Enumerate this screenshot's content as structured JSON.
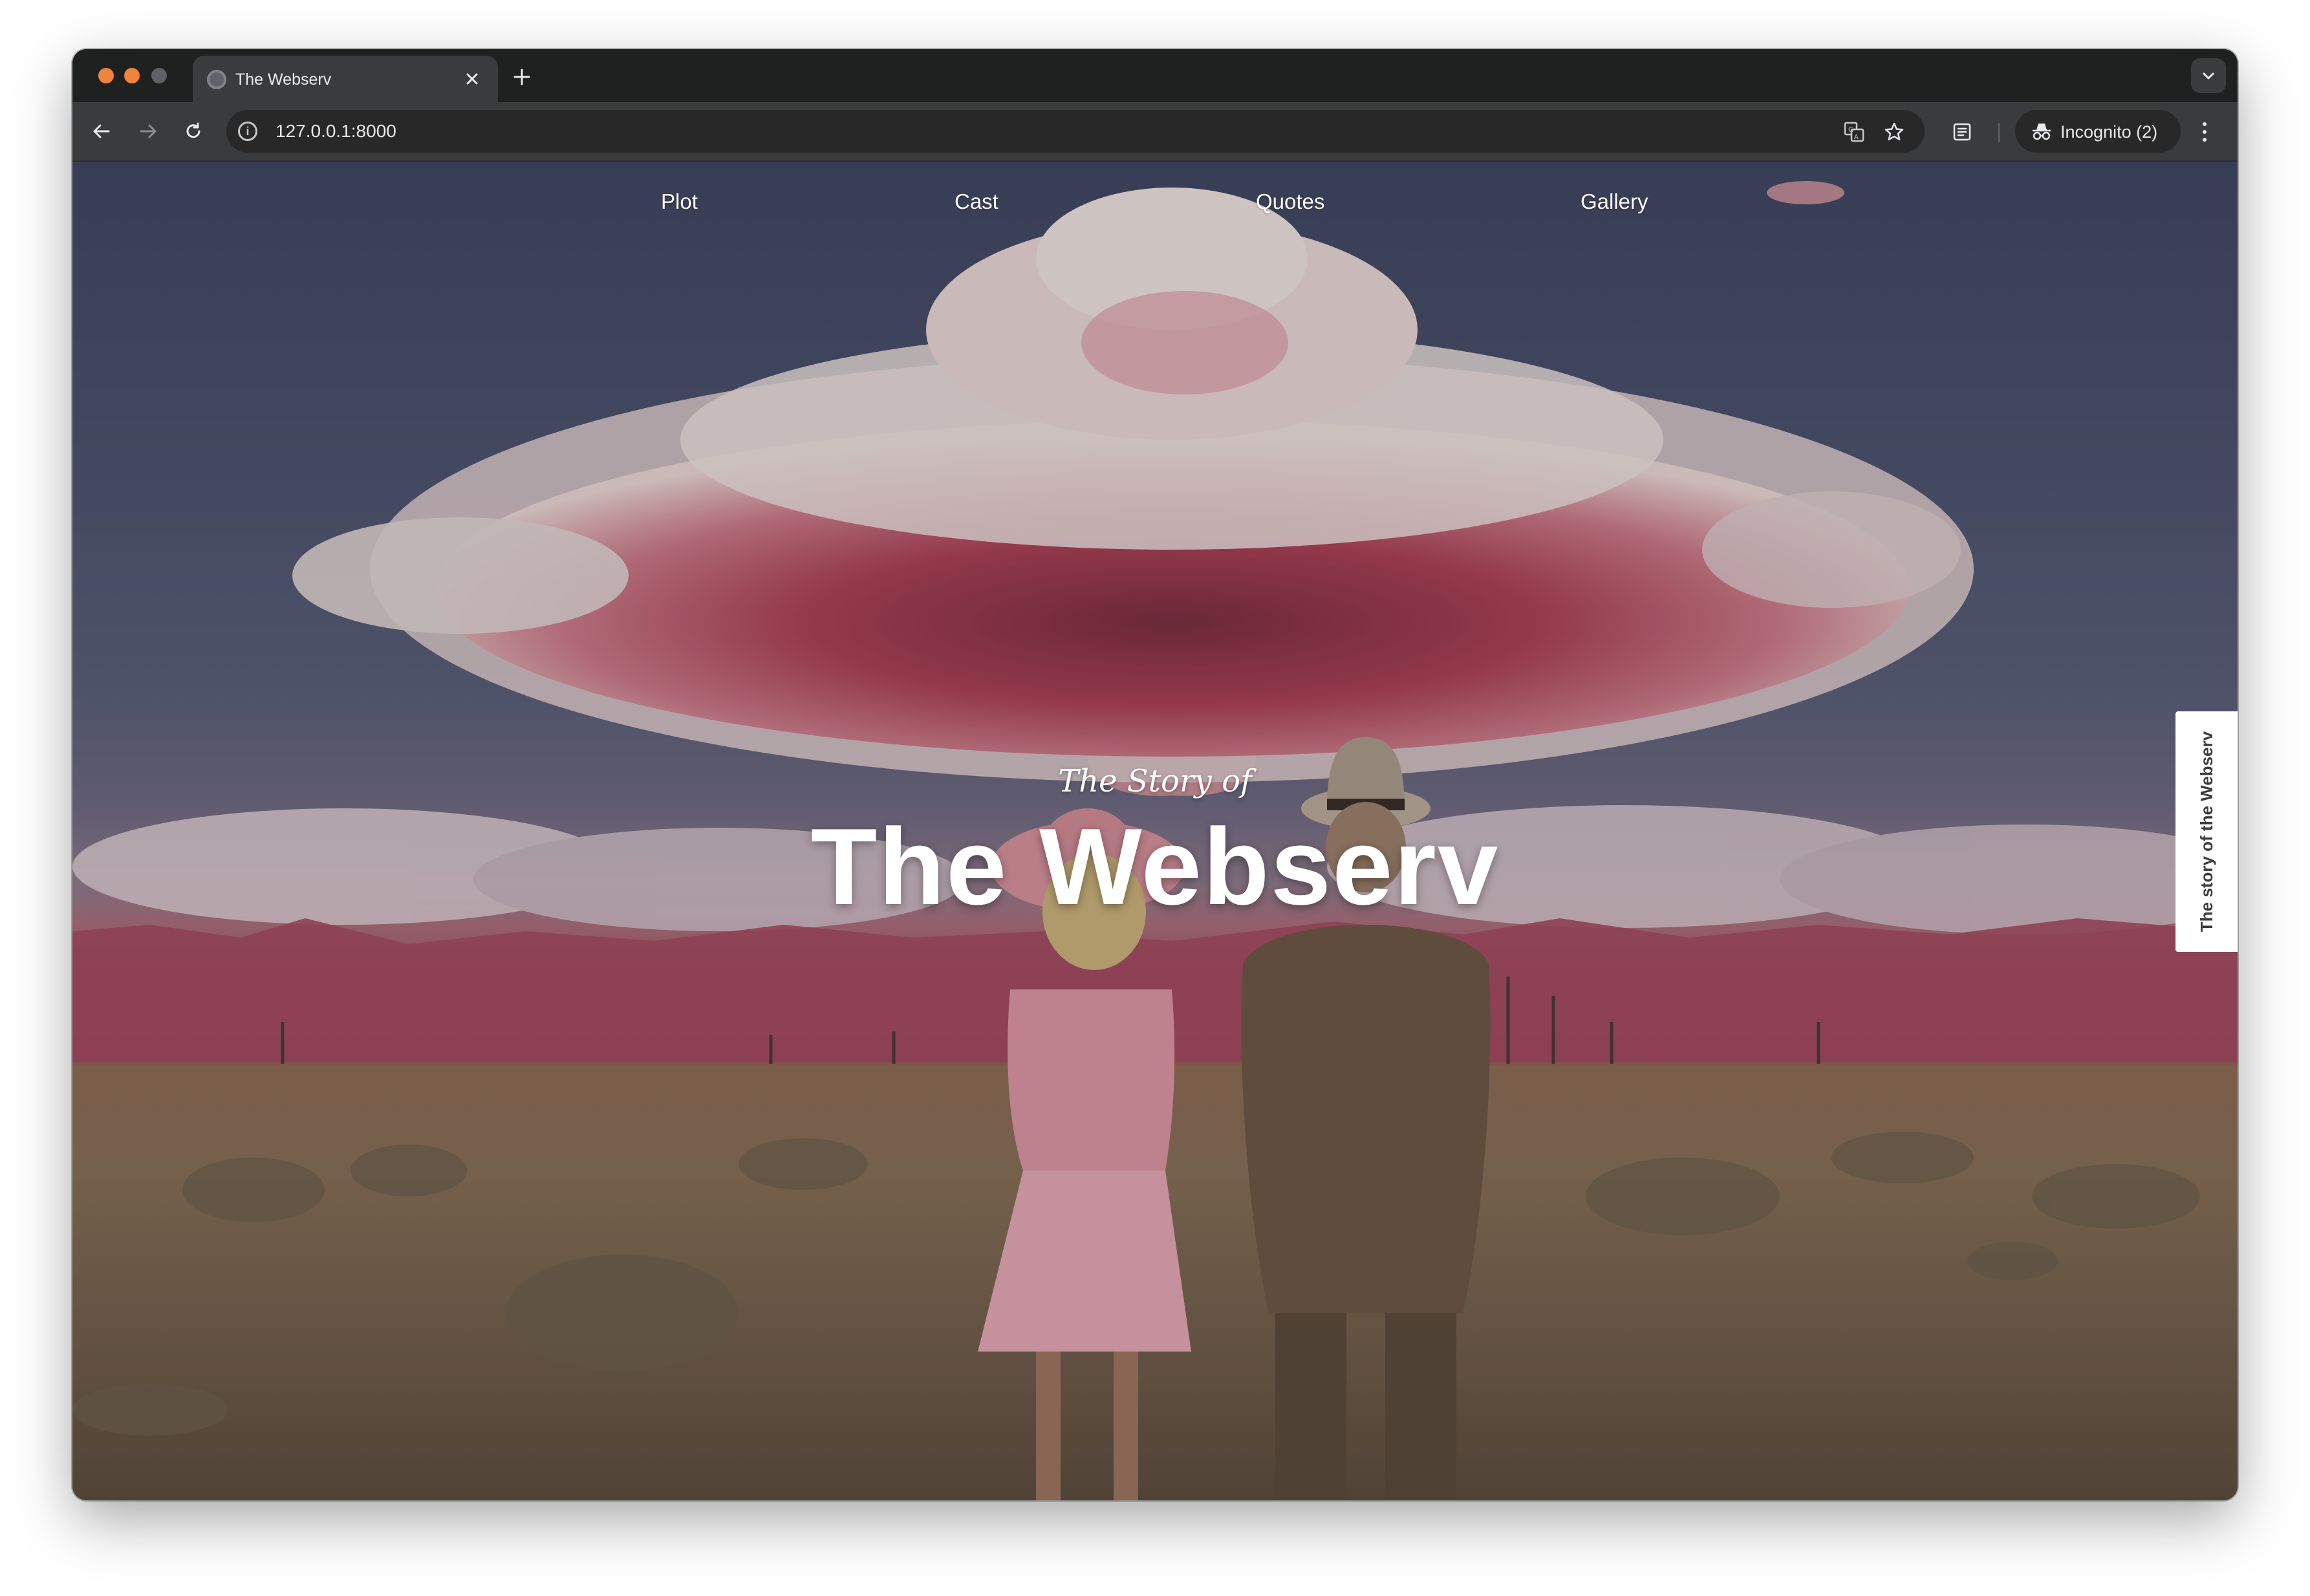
{
  "browser": {
    "tab": {
      "title": "The Webserv",
      "favicon_icon": "globe-icon",
      "close_icon": "close-icon"
    },
    "new_tab_icon": "plus-icon",
    "tab_search_icon": "chevron-down-icon",
    "toolbar": {
      "back_icon": "arrow-left-icon",
      "forward_icon": "arrow-right-icon",
      "reload_icon": "reload-icon",
      "url": "127.0.0.1:8000",
      "site_info_icon": "info-icon",
      "translate_icon": "translate-icon",
      "bookmark_icon": "star-icon",
      "reading_mode_icon": "reading-list-icon",
      "incognito_label": "Incognito (2)",
      "incognito_icon": "incognito-icon",
      "menu_icon": "kebab-menu-icon"
    },
    "colors": {
      "frame": "#1f2020",
      "toolbar": "#3a3b3d",
      "omnibox": "#282828",
      "traffic_close": "#f0843a",
      "traffic_min": "#f0843a",
      "traffic_max": "#5f6166"
    }
  },
  "page": {
    "nav": [
      {
        "label": "Plot"
      },
      {
        "label": "Cast"
      },
      {
        "label": "Quotes"
      },
      {
        "label": "Gallery"
      }
    ],
    "hero": {
      "subtitle": "The Story of",
      "title": "The Webserv",
      "background_image": "pink mushroom cloud over a desert with a couple in retro clothing"
    },
    "side_tab": {
      "label": "The story of the Webserv"
    },
    "colors": {
      "sky": "#4a516c",
      "cloud_pink": "#c0586e",
      "mountains": "#9b4157",
      "desert": "#8c735a",
      "text": "#ffffff"
    }
  }
}
